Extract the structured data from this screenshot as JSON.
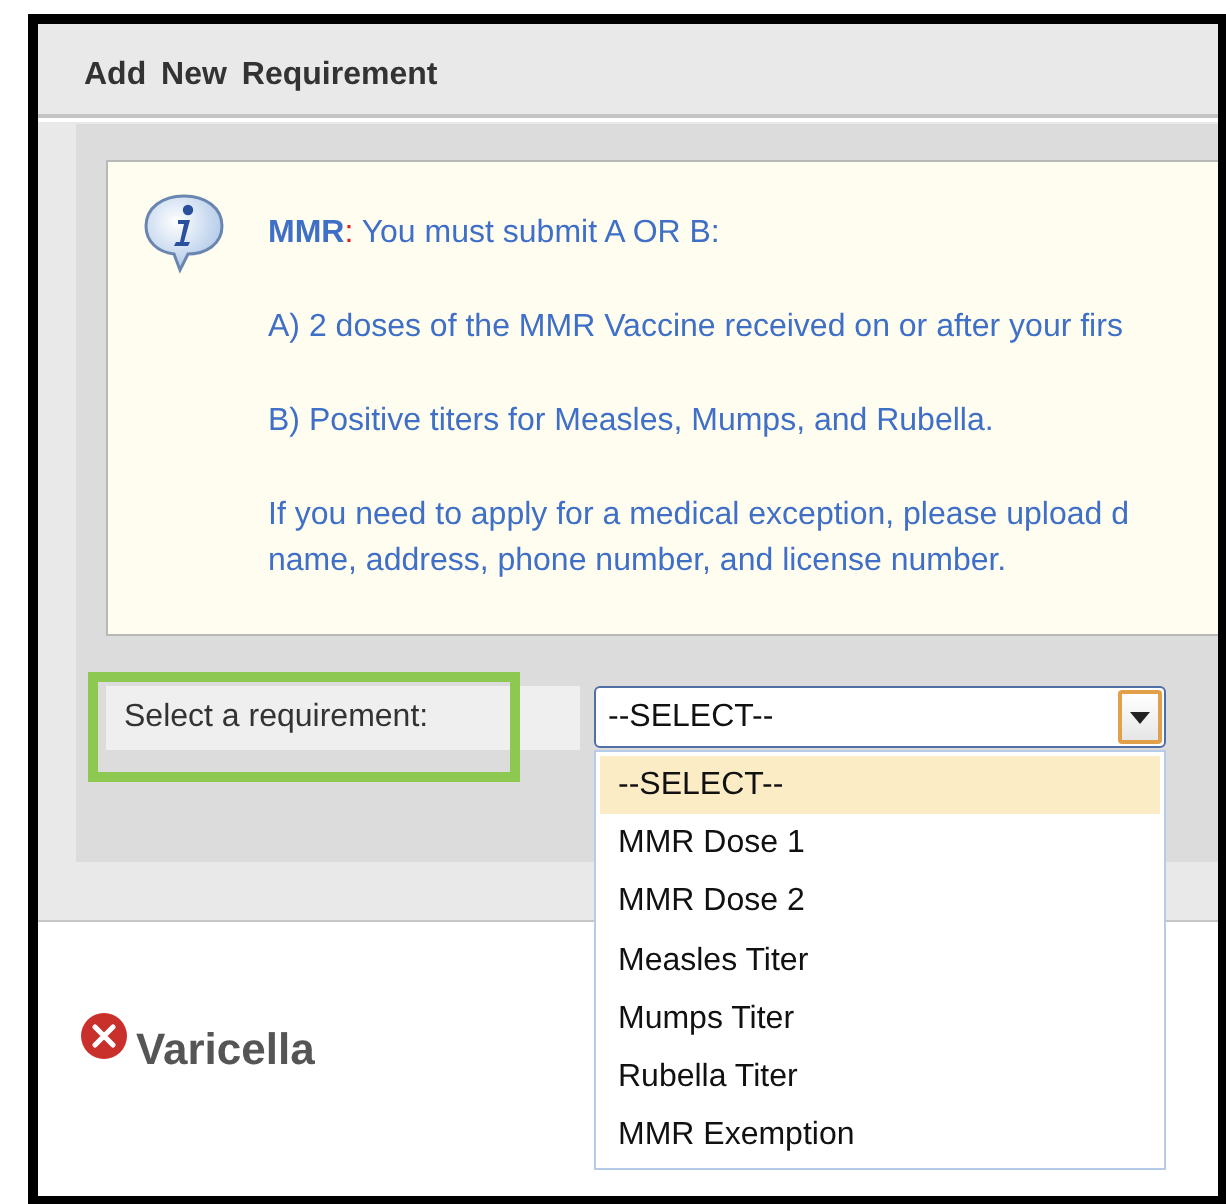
{
  "dialog": {
    "title": "Add New Requirement"
  },
  "info": {
    "label": "MMR",
    "separator": ":",
    "heading": "You must submit A OR B:",
    "paragraphs": [
      {
        "lines": [
          "A) 2 doses of the MMR Vaccine received on or after your firs"
        ]
      },
      {
        "lines": [
          "B) Positive titers for Measles, Mumps, and Rubella."
        ]
      },
      {
        "lines": [
          "If you need to apply for a medical exception, please upload d",
          "name, address, phone number, and license number."
        ]
      }
    ]
  },
  "requirement_select": {
    "label": "Select a requirement:",
    "value": "--SELECT--",
    "expanded": true,
    "options": [
      {
        "label": "--SELECT--",
        "selected": true
      },
      {
        "label": "MMR Dose 1",
        "selected": false
      },
      {
        "label": "MMR Dose 2",
        "selected": false
      },
      {
        "label": "Measles Titer",
        "selected": false
      },
      {
        "label": "Mumps Titer",
        "selected": false
      },
      {
        "label": "Rubella Titer",
        "selected": false
      },
      {
        "label": "MMR Exemption",
        "selected": false
      }
    ]
  },
  "requirements": [
    {
      "name": "Varicella",
      "complete": false
    }
  ]
}
